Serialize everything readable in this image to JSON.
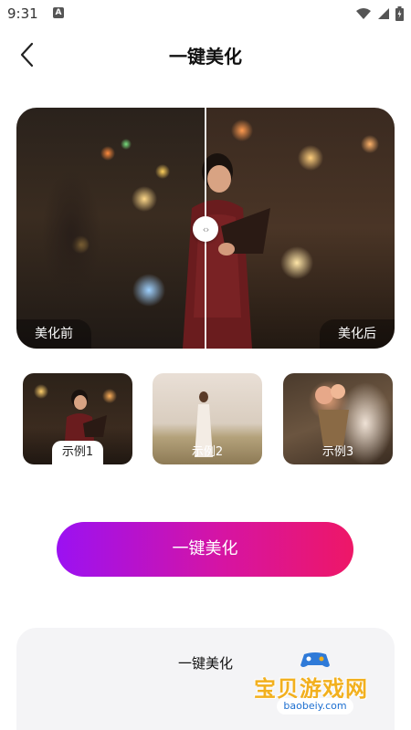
{
  "status_bar": {
    "time": "9:31",
    "notification_icon": "A"
  },
  "header": {
    "title": "一键美化",
    "back_icon": "chevron-left-icon"
  },
  "compare": {
    "before_label": "美化前",
    "after_label": "美化后",
    "handle_icon": "‹›"
  },
  "samples": [
    {
      "label": "示例1",
      "selected": true
    },
    {
      "label": "示例2",
      "selected": false
    },
    {
      "label": "示例3",
      "selected": false
    }
  ],
  "cta": {
    "label": "一键美化",
    "colors": [
      "#9b11f2",
      "#ee1767"
    ]
  },
  "panel": {
    "title": "一键美化"
  },
  "watermark": {
    "text": "宝贝游戏网",
    "url": "baobeiy.com"
  }
}
